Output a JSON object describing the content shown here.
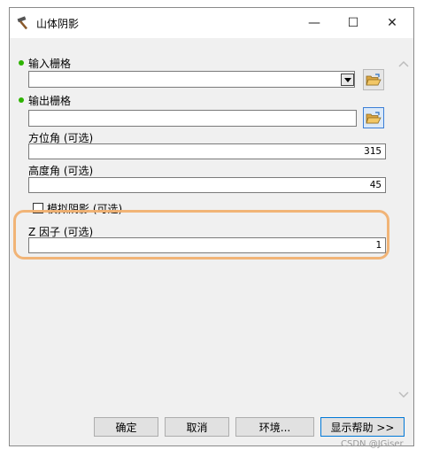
{
  "window": {
    "title": "山体阴影",
    "controls": {
      "minimize": "—",
      "maximize": "☐",
      "close": "✕"
    }
  },
  "form": {
    "input_raster": {
      "label": "输入栅格",
      "value": "",
      "required": true
    },
    "output_raster": {
      "label": "输出栅格",
      "value": "",
      "required": true
    },
    "azimuth": {
      "label": "方位角 (可选)",
      "value": "315"
    },
    "altitude": {
      "label": "高度角 (可选)",
      "value": "45"
    },
    "model_shadows": {
      "label": "模拟阴影 (可选)",
      "checked": false
    },
    "z_factor": {
      "label": "Z 因子 (可选)",
      "value": "1"
    }
  },
  "buttons": {
    "ok": "确定",
    "cancel": "取消",
    "environments": "环境...",
    "show_help": "显示帮助 >>"
  },
  "watermark": "CSDN @JGiser",
  "colors": {
    "required_dot": "#2db300",
    "highlight": "#f0b070"
  },
  "icons": {
    "app": "hammer-icon",
    "browse": "folder-open-icon",
    "dropdown": "chevron-down-icon",
    "scroll_up": "scroll-up-arrow-icon",
    "scroll_down": "scroll-down-arrow-icon"
  }
}
